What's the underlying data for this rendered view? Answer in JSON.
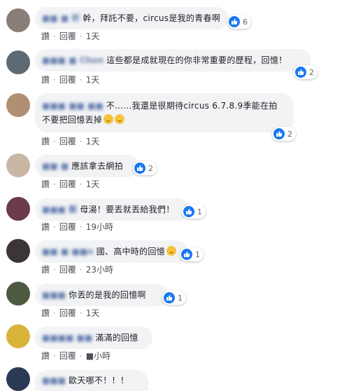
{
  "comments": [
    {
      "name": "■■ ■ 昕",
      "text": "幹，拜託不要，circus是我的青春啊",
      "reactions": "6",
      "actions": {
        "like": "讚",
        "reply": "回覆",
        "time": "1天"
      },
      "avatar_color": "#8a7f78"
    },
    {
      "name": "■■■ ■ Chun",
      "text": "這些都是成就現在的你非常重要的歷程，回憶！",
      "reactions": "2",
      "actions": {
        "like": "讚",
        "reply": "回覆",
        "time": "1天"
      },
      "avatar_color": "#5d6a74"
    },
    {
      "name": "■■■ ■■ ■■",
      "line1": "不……我還是很期待circus 6.7.8.9季能在拍",
      "line2": "不要把回憶丟掉",
      "reactions": "2",
      "actions": {
        "like": "讚",
        "reply": "回覆",
        "time": "1天"
      },
      "avatar_color": "#b08f73"
    },
    {
      "name": "■■ ■",
      "text": "應該拿去網拍",
      "reactions": "2",
      "actions": {
        "like": "讚",
        "reply": "回覆",
        "time": "1天"
      },
      "avatar_color": "#c9b6a4"
    },
    {
      "name": "■■■ 鄭",
      "text": "母湯！要丟就丟給我們！",
      "reactions": "1",
      "actions": {
        "like": "讚",
        "reply": "回覆",
        "time": "19小時"
      },
      "avatar_color": "#6b3b4a"
    },
    {
      "name": "■■ ■ ■■n",
      "text": "國、高中時的回憶",
      "reactions": "1",
      "actions": {
        "like": "讚",
        "reply": "回覆",
        "time": "23小時"
      },
      "avatar_color": "#3b3538"
    },
    {
      "name": "■■■",
      "text": "你丟的是我的回憶啊",
      "reactions": "1",
      "actions": {
        "like": "讚",
        "reply": "回覆",
        "time": "1天"
      },
      "avatar_color": "#4d5a40"
    },
    {
      "name": "■■■■ ■■",
      "text": "滿滿的回憶",
      "actions": {
        "like": "讚",
        "reply": "回覆",
        "time": "■小時"
      },
      "avatar_color": "#d8b33a"
    },
    {
      "name": "■■■",
      "text": "歐天哪不！！！",
      "avatar_color": "#2a3a55"
    }
  ],
  "colors": {
    "like_blue": "#1877f2",
    "bubble_bg": "#f2f3f5",
    "name_blue": "#385898"
  },
  "icons": {
    "reaction": "like-icon",
    "emoji": "sad-face-emoji"
  }
}
